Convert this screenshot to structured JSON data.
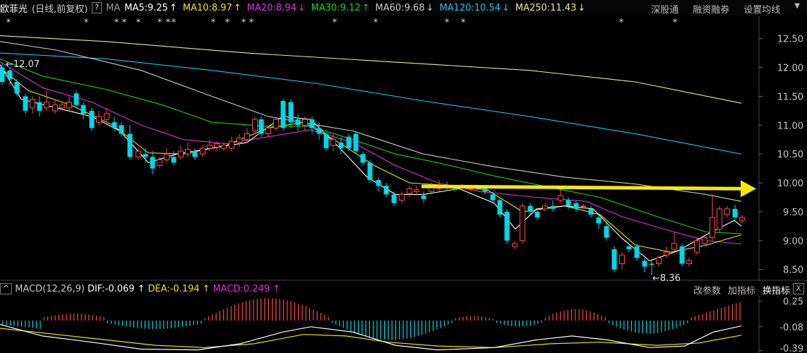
{
  "header": {
    "stock_name": "欧菲光",
    "period": "(日线,前复权)",
    "help": "?",
    "ma_label": "MA",
    "ma_items": [
      {
        "text": "MA5:9.25",
        "arrow": "↑",
        "color": "#ffffff"
      },
      {
        "text": "MA10:8.97",
        "arrow": "↑",
        "color": "#f2e21a"
      },
      {
        "text": "MA20:8.94",
        "arrow": "↓",
        "color": "#e030e0"
      },
      {
        "text": "MA30:9.12",
        "arrow": "↑",
        "color": "#19d219"
      },
      {
        "text": "MA60:9.68",
        "arrow": "↓",
        "color": "#cccccc"
      },
      {
        "text": "MA120:10.54",
        "arrow": "↓",
        "color": "#22c4ee"
      },
      {
        "text": "MA250:11.43",
        "arrow": "↓",
        "color": "#f0e890"
      }
    ],
    "tabs": [
      "深股通",
      "融资融券",
      "设置均线"
    ]
  },
  "macd_header": {
    "toggle": "^",
    "name": "MACD(12,26,9)",
    "dif": "DIF:-0.069",
    "dif_arrow": "↑",
    "dea": "DEA:-0.194",
    "dea_arrow": "↑",
    "macd": "MACD:0.249",
    "macd_arrow": "↑",
    "tabs": [
      "改参数",
      "加指标",
      "换指标"
    ],
    "close": "X"
  },
  "colors": {
    "up": "#ff4a4a",
    "down": "#00d8e8",
    "arrow": "#f5ea00",
    "bg": "#000000"
  },
  "chart_data": {
    "type": "candlestick",
    "y_axis": {
      "ticks": [
        8.5,
        9.0,
        9.5,
        10.0,
        10.5,
        11.0,
        11.5,
        12.0,
        12.5
      ],
      "range": [
        8.3,
        12.9
      ]
    },
    "annotations": {
      "high": "12.07",
      "low": "8.36"
    },
    "markers": "*",
    "macd_axis": {
      "ticks": [
        "0.25",
        "-0.08",
        "-0.39"
      ],
      "range": [
        -0.42,
        0.32
      ]
    }
  }
}
